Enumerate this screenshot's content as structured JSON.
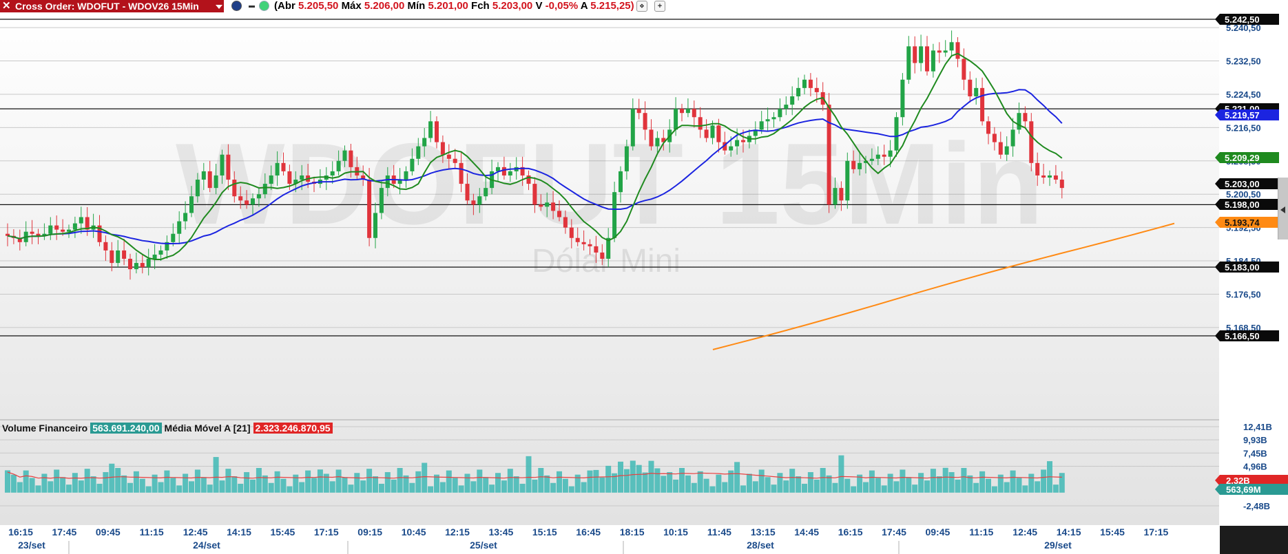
{
  "header": {
    "order_label": "Cross Order: WDOFUT - WDOV26 15Min",
    "close_icon": "close-x-icon",
    "dropdown_icon": "caret-down-icon",
    "ohlc_open_label": "(Abr",
    "ohlc_open": "5.205,50",
    "ohlc_high_label": "Máx",
    "ohlc_high": "5.206,00",
    "ohlc_low_label": "Mín",
    "ohlc_low": "5.201,00",
    "ohlc_close_label": "Fch",
    "ohlc_close": "5.203,00",
    "ohlc_var_label": "V",
    "ohlc_var": "-0,05%",
    "ohlc_a_label": "A",
    "ohlc_a": "5.215,25)",
    "btn_settings": "⋄",
    "btn_add": "+"
  },
  "toolbar": {
    "count": "7"
  },
  "watermark": {
    "symbol": "WDOFUT 15Min",
    "name": "Dólar Mini"
  },
  "colors": {
    "up": "#22a447",
    "down": "#e0343c",
    "sma_fast": "#1f8a1f",
    "sma_slow": "#1b24e0",
    "sma_long": "#ff8a14",
    "volume": "#3fb8b5",
    "volume_avg": "#e84040"
  },
  "price_axis": {
    "ticks": [
      "5.240,50",
      "5.232,50",
      "5.224,50",
      "5.216,50",
      "5.208,50",
      "5.200,50",
      "5.192,50",
      "5.184,50",
      "5.176,50",
      "5.168,50"
    ],
    "levels": [
      "5.242,50",
      "5.221,00",
      "5.198,00",
      "5.183,00",
      "5.166,50"
    ],
    "tag_sma_slow": "5.219,57",
    "tag_sma_fast": "5.209,29",
    "tag_last": "5.203,00",
    "tag_sma_long": "5.193,74"
  },
  "volume_panel": {
    "label": "Volume Financeiro",
    "value": "563.691.240,00",
    "ma_label": "Média Móvel A [21]",
    "ma_value": "2.323.246.870,95",
    "ticks": [
      "12,41B",
      "9,93B",
      "7,45B",
      "4,96B",
      "-2,48B"
    ],
    "tag_ma": "2,32B",
    "tag_vol": "563,69M"
  },
  "time_axis": {
    "times": [
      "16:15",
      "17:45",
      "09:45",
      "11:15",
      "12:45",
      "14:15",
      "15:45",
      "17:15",
      "09:15",
      "10:45",
      "12:15",
      "13:45",
      "15:15",
      "16:45",
      "18:15",
      "10:15",
      "11:45",
      "13:15",
      "14:45",
      "16:15",
      "17:45",
      "09:45",
      "11:15",
      "12:45",
      "14:15",
      "15:45",
      "17:15"
    ],
    "dates": [
      "23/set",
      "24/set",
      "25/set",
      "28/set",
      "29/set"
    ]
  },
  "chart_data": {
    "type": "candlestick",
    "title": "WDOFUT 15Min",
    "ylim": [
      5163,
      5244
    ],
    "close": [
      5190.5,
      5190,
      5189,
      5191.5,
      5191,
      5190.5,
      5191,
      5193,
      5192,
      5191.5,
      5192,
      5193.5,
      5195,
      5192,
      5193,
      5189,
      5187,
      5184,
      5187,
      5185,
      5182.5,
      5184,
      5183,
      5185,
      5186,
      5187,
      5189,
      5191,
      5194,
      5196,
      5200,
      5204,
      5206,
      5202,
      5205,
      5210,
      5204,
      5200,
      5199,
      5198,
      5199.5,
      5200.5,
      5203,
      5205,
      5208,
      5206,
      5203,
      5204,
      5205,
      5203.5,
      5203,
      5204,
      5205,
      5206,
      5208.5,
      5211,
      5207,
      5205,
      5204,
      5190,
      5196,
      5202,
      5205,
      5203,
      5204,
      5206,
      5209,
      5212,
      5214,
      5218,
      5213,
      5210,
      5209,
      5208,
      5203,
      5199,
      5198,
      5200,
      5202,
      5206,
      5207,
      5205,
      5206,
      5207,
      5205,
      5203,
      5198,
      5197.5,
      5198.5,
      5196.5,
      5195,
      5192.5,
      5190,
      5189,
      5188.5,
      5188,
      5186.5,
      5185,
      5190,
      5201,
      5206,
      5212,
      5221,
      5220,
      5216,
      5212,
      5214,
      5213,
      5216,
      5221,
      5220,
      5221,
      5219,
      5216,
      5214,
      5217,
      5213,
      5211,
      5212,
      5213.5,
      5213,
      5214.5,
      5216,
      5218,
      5218.5,
      5219,
      5221,
      5222,
      5224,
      5226,
      5228,
      5226,
      5225,
      5222,
      5198,
      5202,
      5199,
      5208.5,
      5206.5,
      5208,
      5208.5,
      5209,
      5210,
      5209.5,
      5211,
      5219,
      5228,
      5236,
      5232,
      5236,
      5230,
      5235,
      5234.5,
      5235,
      5237,
      5233,
      5228,
      5224,
      5226,
      5218,
      5215,
      5213,
      5210,
      5212,
      5216,
      5220,
      5218,
      5208,
      5205,
      5204.5,
      5205,
      5204,
      5202
    ],
    "sma_fast": "21-period (green)",
    "sma_slow": "blue",
    "sma_long": "orange",
    "levels": [
      5242.5,
      5221,
      5198,
      5183,
      5166.5
    ],
    "last": 5203,
    "volume_ylim": [
      -2.48,
      12.41
    ]
  }
}
